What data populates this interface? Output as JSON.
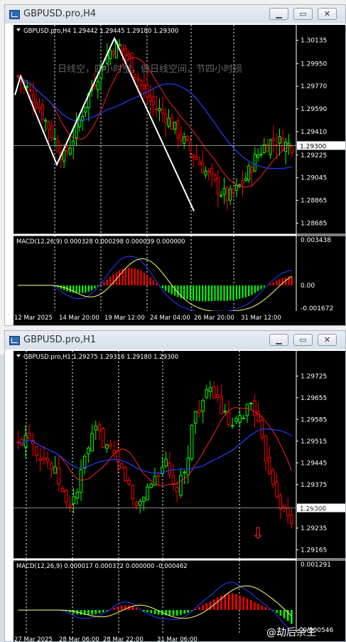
{
  "windows": [
    {
      "title": "GBPUSD.pro,H4",
      "buttons": [
        "minimize",
        "maximize",
        "close"
      ],
      "info": "GBPUSD.pro,H4  1.29442 1.29445 1.29180 1.29300",
      "annotation": "日线空，四小时空，做日线空间，节四小时损",
      "price_ticks": [
        "1.30135",
        "1.29950",
        "1.29770",
        "1.29590",
        "1.29410",
        "1.29225",
        "1.29045",
        "1.28865",
        "1.28685"
      ],
      "current_price": "1.29300",
      "macd_label": "MACD(12,26,9) 0.000328 0.000298 0.000039 0.000000",
      "macd_ticks": [
        "0.003438",
        "0.00",
        "-0.001672"
      ],
      "time_ticks": [
        "12 Mar 2025",
        "14 Mar 20:00",
        "19 Mar 12:00",
        "24 Mar 04:00",
        "26 Mar 20:00",
        "31 Mar 12:00"
      ]
    },
    {
      "title": "GBPUSD.pro,H1",
      "buttons": [
        "minimize",
        "maximize",
        "close"
      ],
      "info": "GBPUSD.pro,H1  1.29275 1.29316 1.29180 1.29300",
      "price_ticks": [
        "1.29725",
        "1.29655",
        "1.29585",
        "1.29515",
        "1.29445",
        "1.29375",
        "1.29305",
        "1.29235",
        "1.29165"
      ],
      "current_price": "1.29300",
      "macd_label": "MACD(12,26,9) 0.000017 0.000372 0.000000 -0.000462",
      "macd_ticks": [
        "0.001291",
        "-0.000546"
      ],
      "time_ticks": [
        "27 Mar 2025",
        "28 Mar 06:00",
        "28 Mar 22:00",
        "31 Mar 06:00"
      ],
      "signal_arrow": "down"
    }
  ],
  "watermark": "@劫后余生",
  "colors": {
    "bull": "#00ff00",
    "bear": "#ff0000",
    "ma_fast": "#ff2020",
    "ma_slow": "#2040ff",
    "macd_signal": "#ffff60",
    "zigzag": "#ffffff",
    "grid": "#ffffff"
  },
  "chart_data": [
    {
      "type": "candlestick",
      "symbol": "GBPUSD.pro",
      "timeframe": "H4",
      "ylim": [
        1.2862,
        1.302
      ],
      "ohlc_last": {
        "open": 1.29442,
        "high": 1.29445,
        "low": 1.2918,
        "close": 1.293
      },
      "price_series": [
        1.2985,
        1.2975,
        1.2965,
        1.295,
        1.2935,
        1.292,
        1.2935,
        1.2955,
        1.2975,
        1.299,
        1.3005,
        1.301,
        1.3,
        1.2985,
        1.297,
        1.296,
        1.2955,
        1.2945,
        1.2935,
        1.2925,
        1.2915,
        1.2905,
        1.2895,
        1.2888,
        1.2895,
        1.2905,
        1.292,
        1.293,
        1.2935,
        1.2932,
        1.293
      ],
      "zigzag": [
        1.297,
        1.2985,
        1.2915,
        1.3015,
        1.2878
      ],
      "macd": {
        "values": [
          0.000328
        ],
        "signal": [
          0.000298
        ],
        "ylim": [
          -0.001672,
          0.003438
        ]
      },
      "x_labels": [
        "12 Mar 2025",
        "14 Mar 20:00",
        "19 Mar 12:00",
        "24 Mar 04:00",
        "26 Mar 20:00",
        "31 Mar 12:00"
      ]
    },
    {
      "type": "candlestick",
      "symbol": "GBPUSD.pro",
      "timeframe": "H1",
      "ylim": [
        1.2915,
        1.2976
      ],
      "ohlc_last": {
        "open": 1.29275,
        "high": 1.29316,
        "low": 1.2918,
        "close": 1.293
      },
      "price_series": [
        1.295,
        1.2955,
        1.2948,
        1.2945,
        1.294,
        1.293,
        1.2935,
        1.2948,
        1.2955,
        1.295,
        1.2945,
        1.294,
        1.293,
        1.2935,
        1.294,
        1.2945,
        1.2935,
        1.294,
        1.296,
        1.2965,
        1.2968,
        1.296,
        1.2955,
        1.296,
        1.2965,
        1.295,
        1.294,
        1.293,
        1.2925
      ],
      "macd": {
        "values": [
          1.7e-05
        ],
        "signal": [
          0.000372
        ],
        "ylim": [
          -0.000546,
          0.001291
        ]
      },
      "x_labels": [
        "27 Mar 2025",
        "28 Mar 06:00",
        "28 Mar 22:00",
        "31 Mar 06:00"
      ]
    }
  ]
}
